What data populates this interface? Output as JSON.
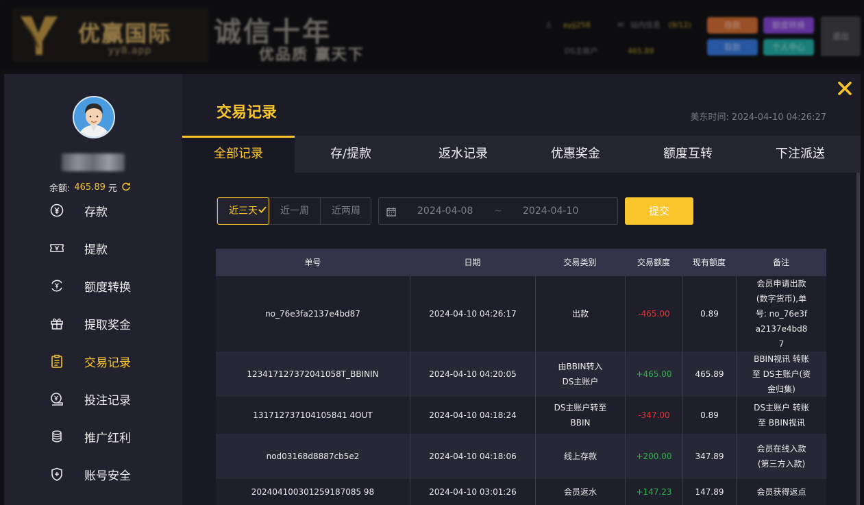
{
  "background": {
    "logo_name": "优赢国际",
    "logo_url": "yy8.app",
    "slogan_line1": "诚信十年",
    "slogan_line2": "优品质  赢天下",
    "user_label": "ayjj258",
    "inbox_label": "站内信息",
    "inbox_count": "(9/12)",
    "ds_account_label": "DS主账户",
    "ds_balance": "465.89",
    "buttons": [
      "存款",
      "额度转换",
      "取款",
      "个人中心"
    ],
    "logout_label": "退出"
  },
  "sidebar": {
    "balance_label": "余额:",
    "balance_value": "465.89",
    "balance_unit": "元",
    "items": [
      {
        "label": "存款",
        "icon": "deposit-icon"
      },
      {
        "label": "提款",
        "icon": "withdraw-icon"
      },
      {
        "label": "额度转换",
        "icon": "transfer-icon"
      },
      {
        "label": "提取奖金",
        "icon": "gift-icon"
      },
      {
        "label": "交易记录",
        "icon": "record-icon",
        "active": true
      },
      {
        "label": "投注记录",
        "icon": "bet-icon"
      },
      {
        "label": "推广红利",
        "icon": "coins-icon"
      },
      {
        "label": "账号安全",
        "icon": "shield-icon"
      }
    ]
  },
  "page": {
    "title": "交易记录",
    "server_time_label": "美东时间:",
    "server_time": "2024-04-10 04:26:27"
  },
  "tabs": [
    "全部记录",
    "存/提款",
    "返水记录",
    "优惠奖金",
    "额度互转",
    "下注派送"
  ],
  "filter": {
    "ranges": [
      "近三天",
      "近一周",
      "近两周"
    ],
    "date_from": "2024-04-08",
    "date_separator": "~",
    "date_to": "2024-04-10",
    "submit_label": "提交"
  },
  "table": {
    "headers": [
      "单号",
      "日期",
      "交易类别",
      "交易额度",
      "现有额度",
      "备注"
    ],
    "rows": [
      {
        "id": "no_76e3fa2137e4bd87",
        "date": "2024-04-10 04:26:17",
        "type": "出款",
        "amount": "-465.00",
        "balance": "0.89",
        "note": "会员申请出款(数字货币),单号: no_76e3fa2137e4bd87"
      },
      {
        "id": "123417127372041058T_BBININ",
        "date": "2024-04-10 04:20:05",
        "type": "由BBIN转入DS主账户",
        "amount": "+465.00",
        "balance": "465.89",
        "note": "BBIN视讯 转账至 DS主账户(资金归集)"
      },
      {
        "id": "131712737104105841 4OUT",
        "date": "2024-04-10 04:18:24",
        "type": "DS主账户转至BBIN",
        "amount": "-347.00",
        "balance": "0.89",
        "note": "DS主账户 转账至 BBIN视讯"
      },
      {
        "id": "nod03168d8887cb5e2",
        "date": "2024-04-10 04:18:06",
        "type": "线上存款",
        "amount": "+200.00",
        "balance": "347.89",
        "note": "会员在线入款(第三方入款)"
      },
      {
        "id": "202404100301259187085 98",
        "date": "2024-04-10 03:01:26",
        "type": "会员返水",
        "amount": "+147.23",
        "balance": "147.89",
        "note": "会员获得返点"
      }
    ]
  },
  "colors": {
    "accent": "#f8c52b",
    "negative": "#e0343a",
    "positive": "#2ab54a"
  }
}
